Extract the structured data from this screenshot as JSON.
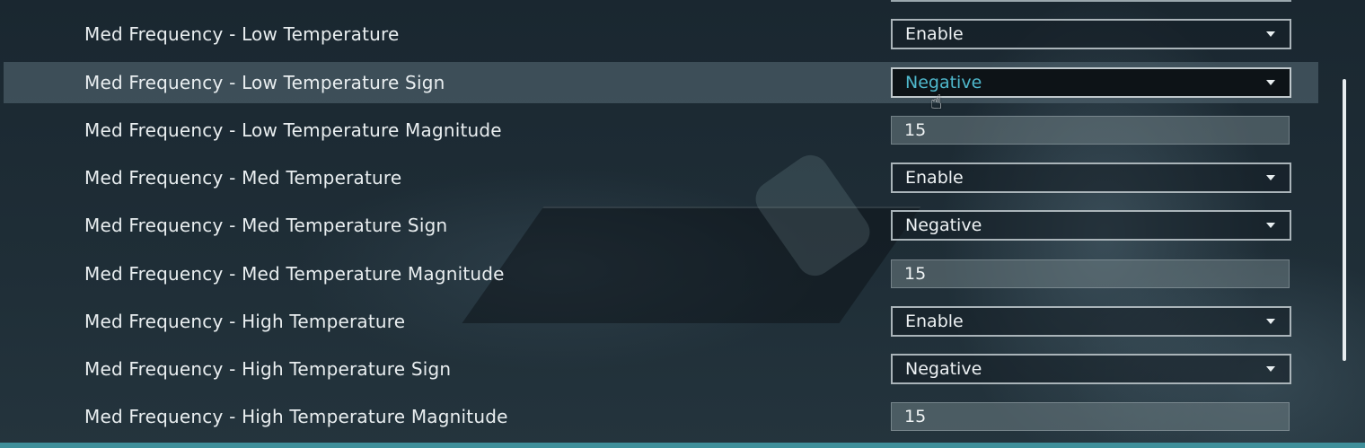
{
  "settings": [
    {
      "label": "Med Frequency - Low Temperature",
      "type": "select",
      "value": "Enable"
    },
    {
      "label": "Med Frequency - Low Temperature Sign",
      "type": "select",
      "value": "Negative"
    },
    {
      "label": "Med Frequency - Low Temperature Magnitude",
      "type": "number",
      "value": "15"
    },
    {
      "label": "Med Frequency - Med Temperature",
      "type": "select",
      "value": "Enable"
    },
    {
      "label": "Med Frequency - Med Temperature Sign",
      "type": "select",
      "value": "Negative"
    },
    {
      "label": "Med Frequency - Med Temperature Magnitude",
      "type": "number",
      "value": "15"
    },
    {
      "label": "Med Frequency - High Temperature",
      "type": "select",
      "value": "Enable"
    },
    {
      "label": "Med Frequency - High Temperature Sign",
      "type": "select",
      "value": "Negative"
    },
    {
      "label": "Med Frequency - High Temperature Magnitude",
      "type": "number",
      "value": "15"
    }
  ],
  "colors": {
    "background": "#1c2a33",
    "active_value": "#4fb8cc",
    "accent_bar": "#3f8f9a"
  },
  "icons": {
    "dropdown": "chevron-down-icon",
    "cursor": "hand-pointer-icon"
  }
}
